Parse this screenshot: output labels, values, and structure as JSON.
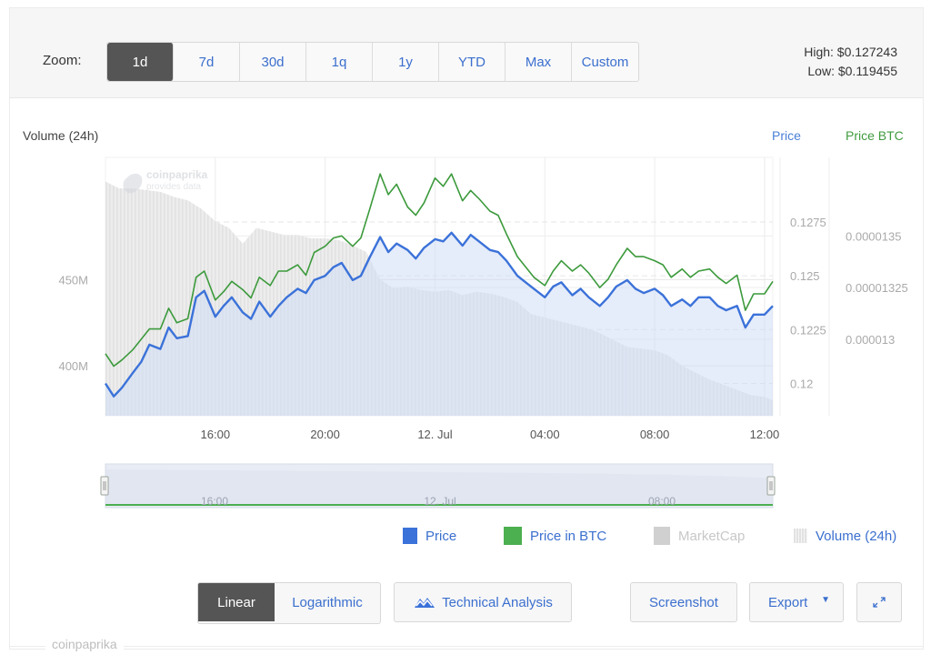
{
  "toolbar": {
    "zoom_label": "Zoom:",
    "zoom_options": [
      {
        "label": "1d",
        "active": true
      },
      {
        "label": "7d",
        "active": false
      },
      {
        "label": "30d",
        "active": false
      },
      {
        "label": "1q",
        "active": false
      },
      {
        "label": "1y",
        "active": false
      },
      {
        "label": "YTD",
        "active": false
      },
      {
        "label": "Max",
        "active": false
      },
      {
        "label": "Custom",
        "active": false
      }
    ],
    "high": "High: $0.127243",
    "low": "Low: $0.119455"
  },
  "axis_titles": {
    "volume": "Volume (24h)",
    "price": "Price",
    "price_btc": "Price BTC"
  },
  "watermark": {
    "line1": "coinpaprika",
    "line2": "provides data"
  },
  "colors": {
    "price": "#3b72d9",
    "price_btc": "#3c9a3c",
    "marketcap": "#e6e6e6",
    "volume": "#d9d9d9",
    "active_button": "#555555",
    "link": "#3b6fce"
  },
  "navigator": {
    "labels": [
      "16:00",
      "12. Jul",
      "08:00"
    ]
  },
  "legend": [
    {
      "label": "Price",
      "color": "#3b72d9",
      "enabled": true
    },
    {
      "label": "Price in BTC",
      "color": "#4caf50",
      "enabled": true
    },
    {
      "label": "MarketCap",
      "color": "#d0d0d0",
      "enabled": false
    },
    {
      "label": "Volume (24h)",
      "color": "#e2e2e2",
      "enabled": true
    }
  ],
  "controls": {
    "linear": "Linear",
    "logarithmic": "Logarithmic",
    "technical_analysis": "Technical Analysis",
    "screenshot": "Screenshot",
    "export": "Export"
  },
  "credit": "coinpaprika",
  "chart_data": {
    "type": "line",
    "title": "",
    "xlabel": "",
    "x_ticks": [
      "16:00",
      "20:00",
      "12. Jul",
      "04:00",
      "08:00",
      "12:00"
    ],
    "x_range_hours": [
      12.0,
      36.3
    ],
    "x_tick_hours": [
      16,
      20,
      24,
      28,
      32,
      36
    ],
    "y_axes": {
      "volume": {
        "label": "Volume (24h)",
        "ticks": [
          "400M",
          "450M"
        ],
        "tick_values": [
          400000000,
          450000000
        ],
        "range": [
          371000000,
          521000000
        ]
      },
      "price": {
        "label": "Price",
        "ticks": [
          "0.12",
          "0.1225",
          "0.125",
          "0.1275"
        ],
        "tick_values": [
          0.12,
          0.1225,
          0.125,
          0.1275
        ],
        "range": [
          0.1185,
          0.1305
        ]
      },
      "price_btc": {
        "label": "Price BTC",
        "ticks": [
          "0.000013",
          "0.00001325",
          "0.0000135"
        ],
        "tick_values": [
          1.3e-05,
          1.325e-05,
          1.35e-05
        ],
        "range": [
          1.263e-05,
          1.388e-05
        ]
      }
    },
    "series": [
      {
        "name": "Price",
        "axis": "price",
        "x": [
          12.0,
          12.3,
          12.6,
          13.0,
          13.3,
          13.6,
          14.0,
          14.3,
          14.6,
          15.0,
          15.3,
          15.6,
          16.0,
          16.3,
          16.6,
          17.0,
          17.3,
          17.6,
          18.0,
          18.3,
          18.6,
          19.0,
          19.3,
          19.6,
          20.0,
          20.3,
          20.6,
          21.0,
          21.3,
          21.6,
          22.0,
          22.3,
          22.6,
          23.0,
          23.3,
          23.6,
          24.0,
          24.3,
          24.6,
          25.0,
          25.3,
          25.6,
          26.0,
          26.3,
          26.6,
          27.0,
          27.3,
          27.6,
          28.0,
          28.3,
          28.6,
          29.0,
          29.3,
          29.6,
          30.0,
          30.3,
          30.6,
          31.0,
          31.3,
          31.6,
          32.0,
          32.3,
          32.6,
          33.0,
          33.3,
          33.6,
          34.0,
          34.3,
          34.6,
          35.0,
          35.3,
          35.6,
          36.0,
          36.3
        ],
        "values": [
          0.12,
          0.1194,
          0.1198,
          0.1205,
          0.121,
          0.1218,
          0.1216,
          0.1226,
          0.1221,
          0.1222,
          0.124,
          0.1243,
          0.1231,
          0.1236,
          0.124,
          0.1233,
          0.123,
          0.1238,
          0.1231,
          0.1236,
          0.124,
          0.1244,
          0.1242,
          0.1248,
          0.125,
          0.1254,
          0.1256,
          0.1248,
          0.125,
          0.1258,
          0.1268,
          0.1261,
          0.1265,
          0.1262,
          0.1258,
          0.1263,
          0.1267,
          0.1266,
          0.127,
          0.1264,
          0.1269,
          0.1266,
          0.1262,
          0.1261,
          0.1257,
          0.125,
          0.1247,
          0.1244,
          0.124,
          0.1245,
          0.1247,
          0.1241,
          0.1244,
          0.124,
          0.1236,
          0.124,
          0.1245,
          0.1248,
          0.1244,
          0.1242,
          0.1244,
          0.1241,
          0.1236,
          0.1239,
          0.1236,
          0.124,
          0.124,
          0.1236,
          0.1234,
          0.1236,
          0.1226,
          0.1232,
          0.1232,
          0.1236
        ]
      },
      {
        "name": "Price in BTC",
        "axis": "price_btc",
        "x": [
          12.0,
          12.3,
          12.6,
          13.0,
          13.3,
          13.6,
          14.0,
          14.3,
          14.6,
          15.0,
          15.3,
          15.6,
          16.0,
          16.3,
          16.6,
          17.0,
          17.3,
          17.6,
          18.0,
          18.3,
          18.6,
          19.0,
          19.3,
          19.6,
          20.0,
          20.3,
          20.6,
          21.0,
          21.3,
          21.6,
          22.0,
          22.3,
          22.6,
          23.0,
          23.3,
          23.6,
          24.0,
          24.3,
          24.6,
          25.0,
          25.3,
          25.6,
          26.0,
          26.3,
          26.6,
          27.0,
          27.3,
          27.6,
          28.0,
          28.3,
          28.6,
          29.0,
          29.3,
          29.6,
          30.0,
          30.3,
          30.6,
          31.0,
          31.3,
          31.6,
          32.0,
          32.3,
          32.6,
          33.0,
          33.3,
          33.6,
          34.0,
          34.3,
          34.6,
          35.0,
          35.3,
          35.6,
          36.0,
          36.3
        ],
        "values": [
          1.293e-05,
          1.287e-05,
          1.29e-05,
          1.295e-05,
          1.3e-05,
          1.305e-05,
          1.305e-05,
          1.315e-05,
          1.308e-05,
          1.31e-05,
          1.33e-05,
          1.333e-05,
          1.319e-05,
          1.323e-05,
          1.328e-05,
          1.324e-05,
          1.32e-05,
          1.33e-05,
          1.326e-05,
          1.333e-05,
          1.333e-05,
          1.336e-05,
          1.331e-05,
          1.342e-05,
          1.345e-05,
          1.349e-05,
          1.35e-05,
          1.345e-05,
          1.349e-05,
          1.362e-05,
          1.38e-05,
          1.37e-05,
          1.375e-05,
          1.364e-05,
          1.36e-05,
          1.366e-05,
          1.378e-05,
          1.374e-05,
          1.38e-05,
          1.367e-05,
          1.372e-05,
          1.368e-05,
          1.362e-05,
          1.36e-05,
          1.351e-05,
          1.34e-05,
          1.335e-05,
          1.33e-05,
          1.326e-05,
          1.333e-05,
          1.338e-05,
          1.333e-05,
          1.336e-05,
          1.332e-05,
          1.325e-05,
          1.329e-05,
          1.336e-05,
          1.344e-05,
          1.34e-05,
          1.34e-05,
          1.338e-05,
          1.336e-05,
          1.33e-05,
          1.334e-05,
          1.33e-05,
          1.333e-05,
          1.334e-05,
          1.33e-05,
          1.327e-05,
          1.331e-05,
          1.314e-05,
          1.322e-05,
          1.322e-05,
          1.328e-05
        ]
      },
      {
        "name": "Volume (24h)",
        "axis": "volume",
        "type": "area",
        "x": [
          12.0,
          12.5,
          13.0,
          13.5,
          14.0,
          14.5,
          15.0,
          15.5,
          16.0,
          16.5,
          17.0,
          17.5,
          18.0,
          18.5,
          19.0,
          19.5,
          20.0,
          20.5,
          21.0,
          21.5,
          22.0,
          22.5,
          23.0,
          23.5,
          24.0,
          24.5,
          25.0,
          25.5,
          26.0,
          26.5,
          27.0,
          27.5,
          28.0,
          28.5,
          29.0,
          29.5,
          30.0,
          30.5,
          31.0,
          31.5,
          32.0,
          32.5,
          33.0,
          33.5,
          34.0,
          34.5,
          35.0,
          35.5,
          36.0,
          36.3
        ],
        "values": [
          507000000,
          503000000,
          503000000,
          502000000,
          501000000,
          498000000,
          496000000,
          491000000,
          484000000,
          480000000,
          471000000,
          480000000,
          478000000,
          476000000,
          476000000,
          474000000,
          474000000,
          473000000,
          470000000,
          466000000,
          450000000,
          445000000,
          446000000,
          444000000,
          443000000,
          444000000,
          441000000,
          443000000,
          442000000,
          440000000,
          437000000,
          430000000,
          428000000,
          426000000,
          424000000,
          422000000,
          419000000,
          415000000,
          411000000,
          410000000,
          409000000,
          406000000,
          400000000,
          396000000,
          392000000,
          389000000,
          386000000,
          383000000,
          382000000,
          380000000
        ]
      }
    ],
    "legend_position": "bottom-right",
    "grid": true
  }
}
